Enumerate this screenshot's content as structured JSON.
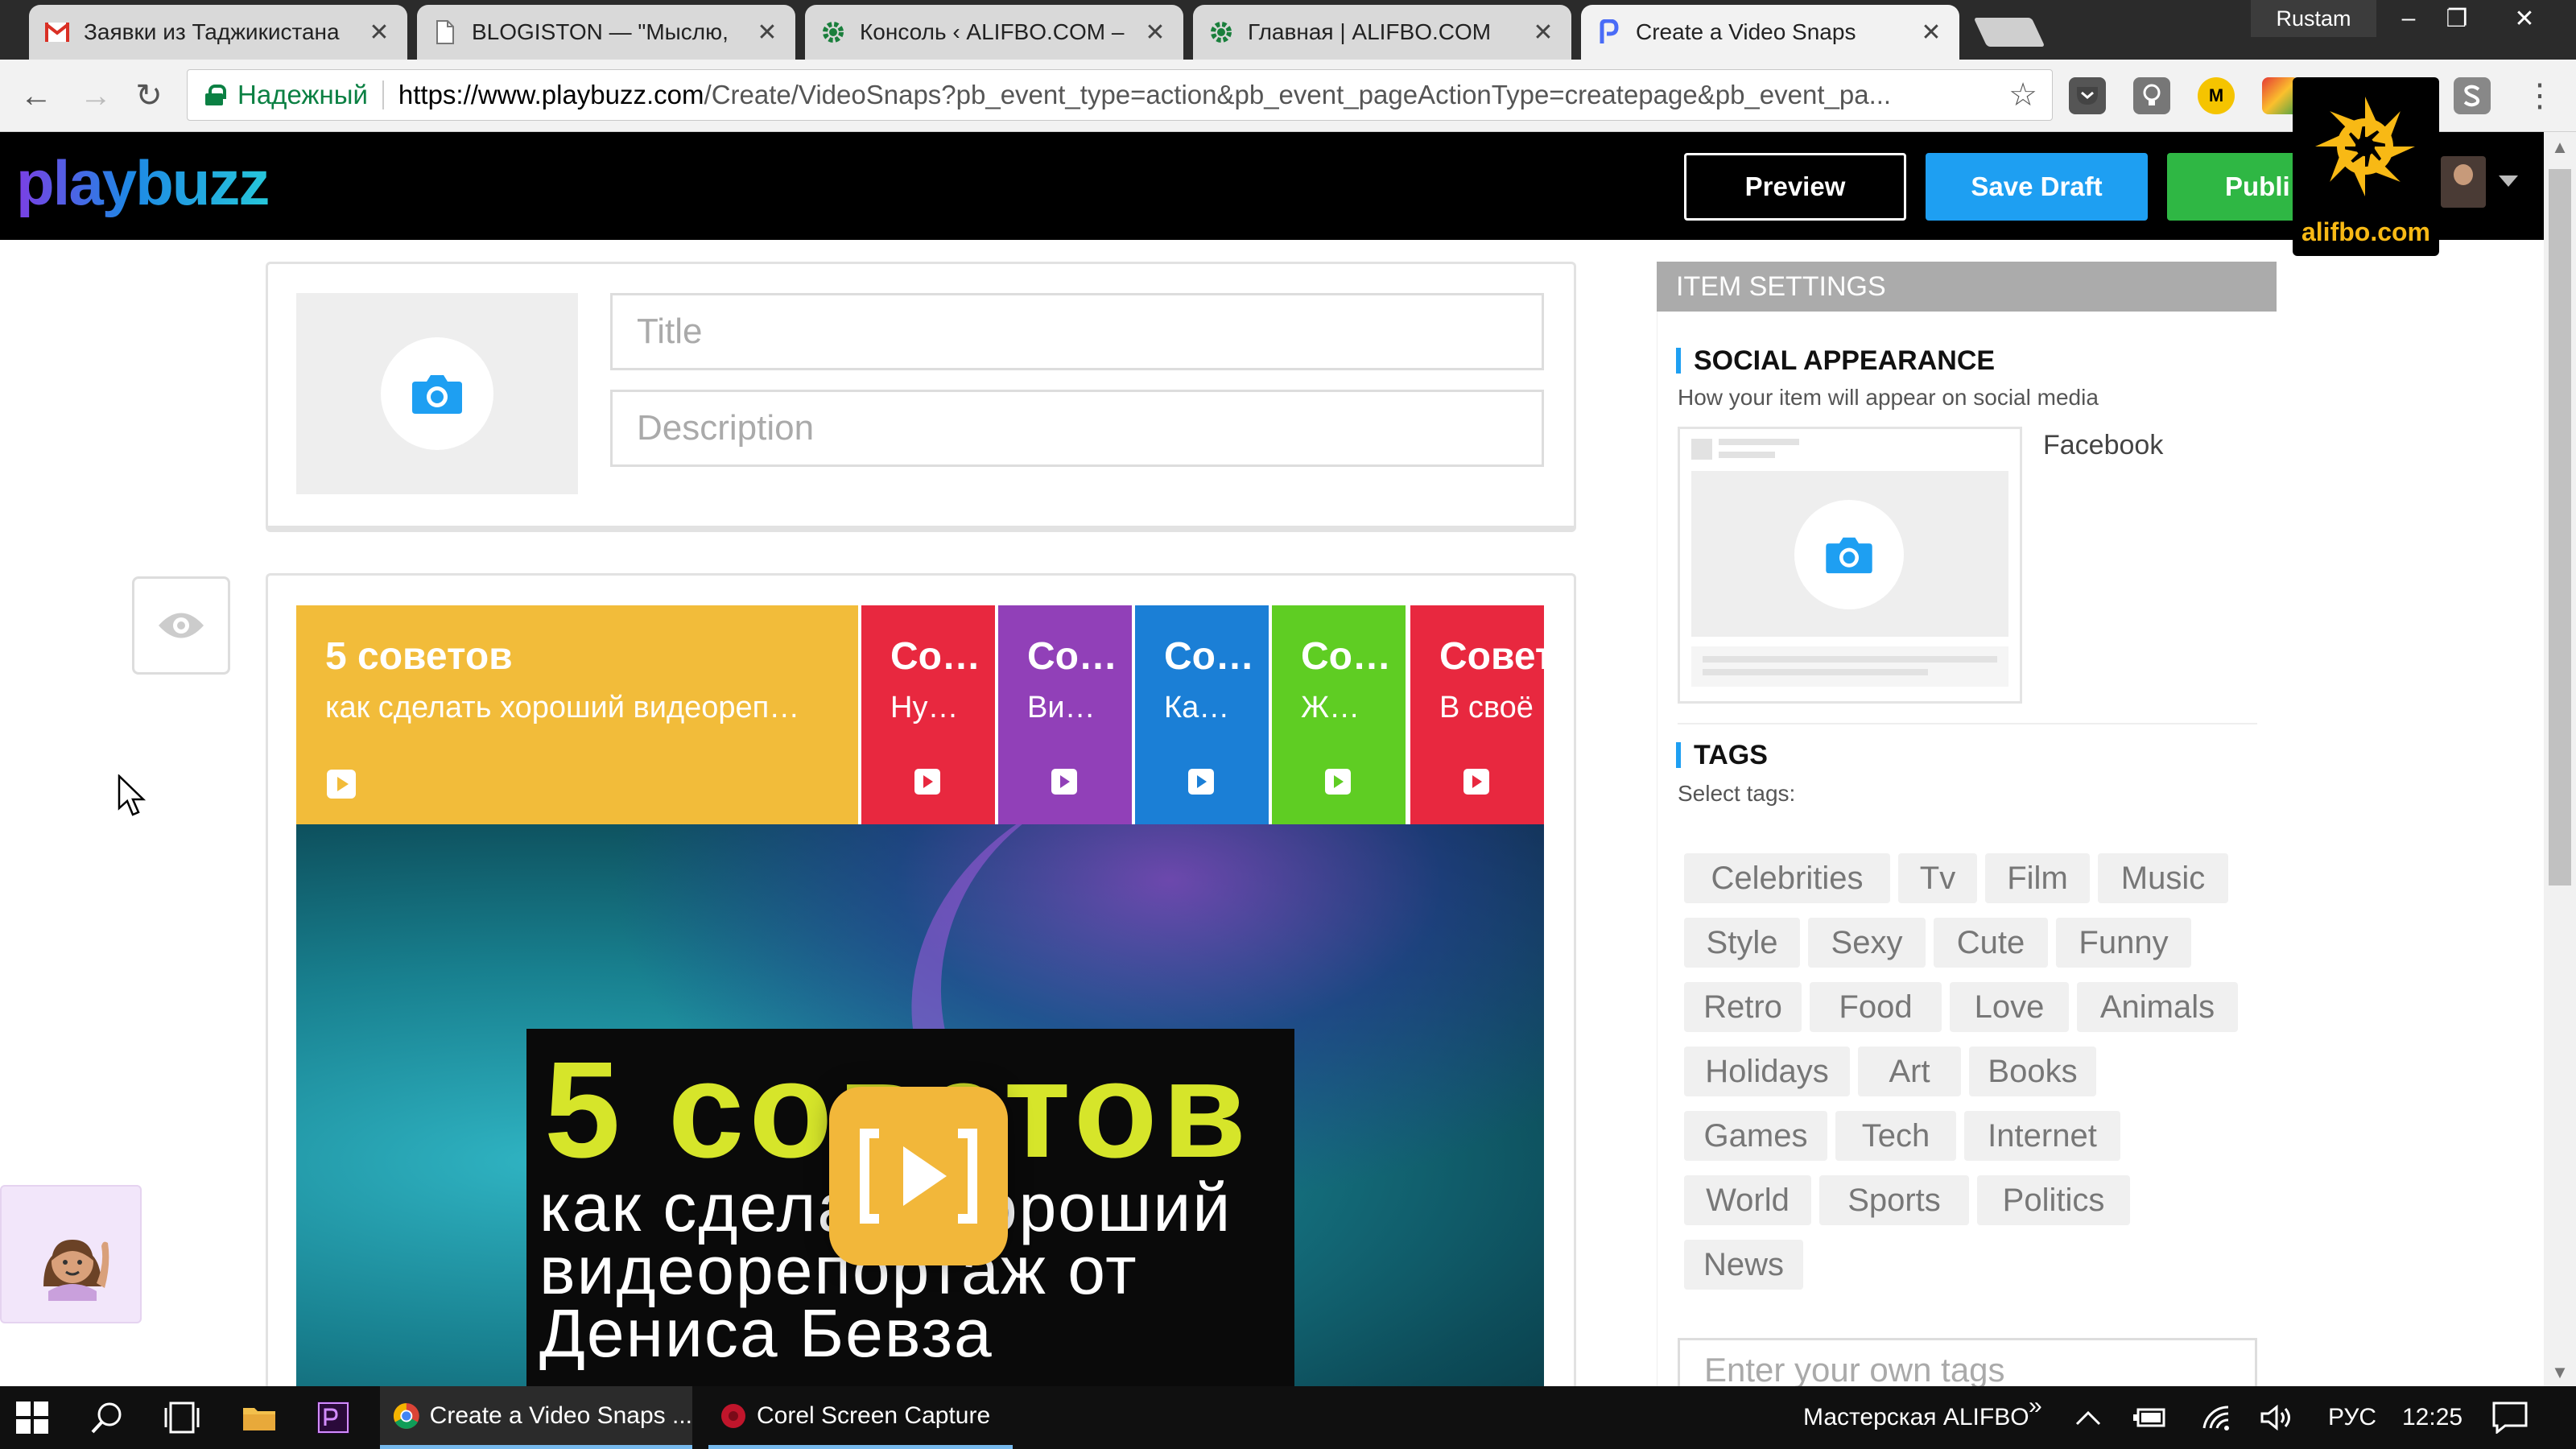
{
  "browser": {
    "tabs": [
      {
        "title": "Заявки из Таджикистана",
        "icon": "gmail-icon"
      },
      {
        "title": "BLOGISTON — \"Мыслю,",
        "icon": "page-icon"
      },
      {
        "title": "Консоль ‹ ALIFBO.COM –",
        "icon": "gear-site-icon"
      },
      {
        "title": "Главная | ALIFBO.COM",
        "icon": "gear-site-icon"
      },
      {
        "title": "Create a Video Snaps",
        "icon": "playbuzz-icon"
      }
    ],
    "window_user": "Rustam",
    "secure_label": "Надежный",
    "url_host": "https://www.playbuzz.com",
    "url_path": "/Create/VideoSnaps?pb_event_type=action&pb_event_pageActionType=createpage&pb_event_pa...",
    "ext_m_label": "M"
  },
  "header": {
    "logo": "playbuzz",
    "preview_label": "Preview",
    "save_draft_label": "Save Draft",
    "publish_label": "Publi"
  },
  "overlay": {
    "alifbo_label": "alifbo.com"
  },
  "editor": {
    "title_placeholder": "Title",
    "description_placeholder": "Description"
  },
  "snaps": [
    {
      "title": "5 советов",
      "subtitle": "как сделать хороший видеореп…",
      "color": "#f2bc3a"
    },
    {
      "title": "Co…",
      "subtitle": "Ну…",
      "color": "#e8283f"
    },
    {
      "title": "Co…",
      "subtitle": "Ви…",
      "color": "#9140b8"
    },
    {
      "title": "Co…",
      "subtitle": "Ка…",
      "color": "#1b7fd6"
    },
    {
      "title": "Co…",
      "subtitle": "Ж…",
      "color": "#5fcd23"
    },
    {
      "title": "Совет",
      "subtitle": "В своё",
      "color": "#e8283f"
    }
  ],
  "video": {
    "line1": "5 советов",
    "line2": "как сделать хороший",
    "line3": "видеорепортаж от",
    "line4": "Дениса Бевза"
  },
  "settings": {
    "header": "ITEM SETTINGS",
    "social_title": "SOCIAL APPEARANCE",
    "social_sub": "How your item will appear on social media",
    "facebook_label": "Facebook",
    "tags_title": "TAGS",
    "tags_sub": "Select tags:",
    "tags": [
      "Celebrities",
      "Tv",
      "Film",
      "Music",
      "Style",
      "Sexy",
      "Cute",
      "Funny",
      "Retro",
      "Food",
      "Love",
      "Animals",
      "Holidays",
      "Art",
      "Books",
      "Games",
      "Tech",
      "Internet",
      "World",
      "Sports",
      "Politics",
      "News"
    ],
    "tag_input_placeholder": "Enter your own tags"
  },
  "taskbar": {
    "chrome_label": "Create a Video Snaps ...",
    "corel_label": "Corel Screen Capture",
    "workspace_label": "Мастерская ALIFBO",
    "lang": "РУС",
    "time": "12:25"
  },
  "colors": {
    "save_blue": "#1e9ff2",
    "publish_green": "#2fb744",
    "accent_bar": "#1e9ff2",
    "alifbo_yellow": "#f8b915"
  }
}
